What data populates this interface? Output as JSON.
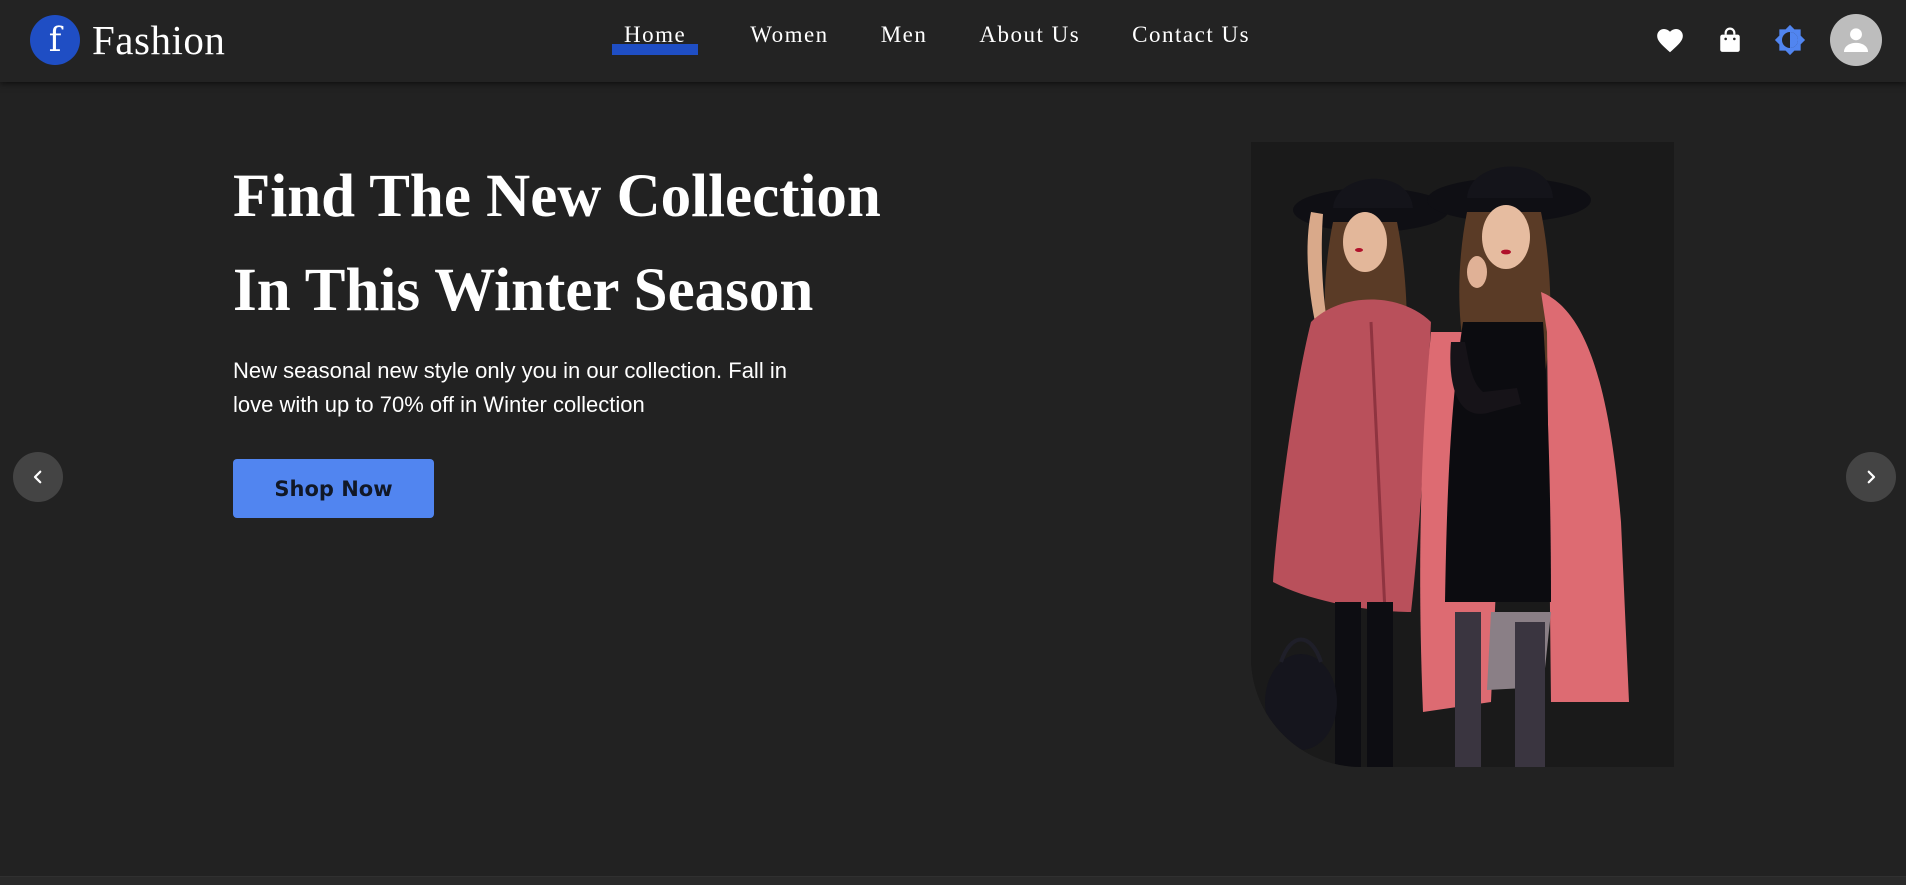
{
  "brand": {
    "logo_letter": "f",
    "name": "Fashion",
    "accent_color": "#1f4ec4"
  },
  "nav": {
    "items": [
      {
        "label": "Home",
        "active": true
      },
      {
        "label": "Women",
        "active": false
      },
      {
        "label": "Men",
        "active": false
      },
      {
        "label": "About Us",
        "active": false
      },
      {
        "label": "Contact Us",
        "active": false
      }
    ]
  },
  "header_icons": [
    "heart-icon",
    "shopping-bag-icon",
    "theme-toggle-icon",
    "user-avatar-icon"
  ],
  "hero": {
    "title_line1": "Find The New Collection",
    "title_line2": "In This Winter Season",
    "description": "New seasonal new style only you in our collection. Fall in love with up to 70% off in Winter collection",
    "cta_label": "Shop Now",
    "cta_color": "#5185f0",
    "image": "two-women-in-pink-coats-and-black-hats"
  },
  "carousel": {
    "prev_icon": "chevron-left-icon",
    "next_icon": "chevron-right-icon"
  }
}
